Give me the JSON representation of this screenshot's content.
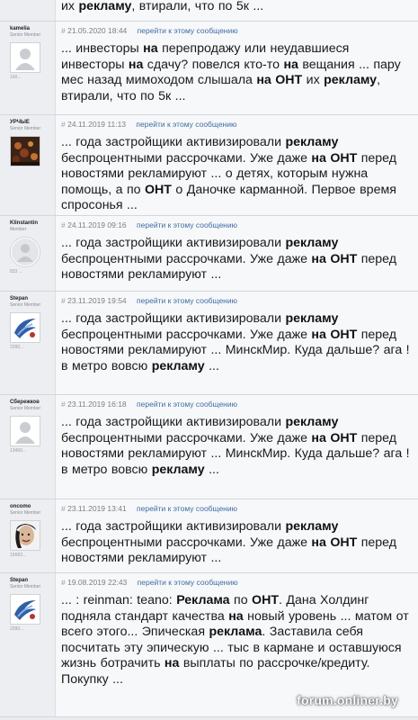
{
  "posts": [
    {
      "author": "",
      "rank": "",
      "count": "",
      "avatar": "none",
      "date": "",
      "link": "",
      "segments": [
        {
          "t": "их ",
          "b": false
        },
        {
          "t": "рекламу",
          "b": true
        },
        {
          "t": ", втирали, что по 5к ...",
          "b": false
        }
      ]
    },
    {
      "author": "kamelia",
      "rank": "Senior Member",
      "count": "160...",
      "avatar": "placeholder",
      "date": "21.05.2020 18:44",
      "link": "перейти к этому сообщению",
      "segments": [
        {
          "t": "... инвесторы ",
          "b": false
        },
        {
          "t": "на",
          "b": true
        },
        {
          "t": " перепродажу или неудавшиеся инвесторы ",
          "b": false
        },
        {
          "t": "на",
          "b": true
        },
        {
          "t": " сдачу? повелся кто-то ",
          "b": false
        },
        {
          "t": "на",
          "b": true
        },
        {
          "t": " вещания ... пару мес назад мимоходом слышала ",
          "b": false
        },
        {
          "t": "на ОНТ",
          "b": true
        },
        {
          "t": " их ",
          "b": false
        },
        {
          "t": "рекламу",
          "b": true
        },
        {
          "t": ", втирали, что по 5к ...",
          "b": false
        }
      ]
    },
    {
      "author": "УРЧЫЕ",
      "rank": "Senior Member",
      "count": "",
      "avatar": "photo-dark",
      "date": "24.11.2019 11:13",
      "link": "перейти к этому сообщению",
      "segments": [
        {
          "t": "... года застройщики активизировали ",
          "b": false
        },
        {
          "t": "рекламу",
          "b": true
        },
        {
          "t": " беспроцентными рассрочками. Уже даже ",
          "b": false
        },
        {
          "t": "на ОНТ",
          "b": true
        },
        {
          "t": " перед новостями рекламируют ... о детях, которым нужна помощь, а по ",
          "b": false
        },
        {
          "t": "ОНТ",
          "b": true
        },
        {
          "t": " о Даночке карманной. Первое время спросонья ...",
          "b": false
        }
      ]
    },
    {
      "author": "Klinstantin",
      "rank": "Member",
      "count": "833 ...",
      "avatar": "placeholder-circle",
      "date": "24.11.2019 09:16",
      "link": "перейти к этому сообщению",
      "segments": [
        {
          "t": "... года застройщики активизировали ",
          "b": false
        },
        {
          "t": "рекламу",
          "b": true
        },
        {
          "t": " беспроцентными рассрочками. Уже даже ",
          "b": false
        },
        {
          "t": "на ОНТ",
          "b": true
        },
        {
          "t": " перед новостями рекламируют ...",
          "b": false
        }
      ]
    },
    {
      "author": "Stepan",
      "rank": "Senior Member",
      "count": "2390...",
      "avatar": "logo-blue",
      "date": "23.11.2019 19:54",
      "link": "перейти к этому сообщению",
      "segments": [
        {
          "t": "... года застройщики активизировали ",
          "b": false
        },
        {
          "t": "рекламу",
          "b": true
        },
        {
          "t": " беспроцентными рассрочками. Уже даже ",
          "b": false
        },
        {
          "t": "на ОНТ",
          "b": true
        },
        {
          "t": " перед новостями рекламируют ... МинскМир. Куда дальше? ага !в метро вовсю ",
          "b": false
        },
        {
          "t": "рекламу",
          "b": true
        },
        {
          "t": " ...",
          "b": false
        }
      ]
    },
    {
      "author": "Сбережков",
      "rank": "Senior Member",
      "count": "13460...",
      "avatar": "placeholder",
      "date": "23.11.2019 16:18",
      "link": "перейти к этому сообщению",
      "segments": [
        {
          "t": "... года застройщики активизировали ",
          "b": false
        },
        {
          "t": "рекламу",
          "b": true
        },
        {
          "t": " беспроцентными рассрочками. Уже даже ",
          "b": false
        },
        {
          "t": "на ОНТ",
          "b": true
        },
        {
          "t": " перед новостями рекламируют ... МинскМир. Куда дальше? ага !в метро вовсю ",
          "b": false
        },
        {
          "t": "рекламу",
          "b": true
        },
        {
          "t": " ...",
          "b": false
        }
      ]
    },
    {
      "author": "oncomo",
      "rank": "Senior Member",
      "count": "15683...",
      "avatar": "photo-face",
      "date": "23.11.2019 13:41",
      "link": "перейти к этому сообщению",
      "segments": [
        {
          "t": "... года застройщики активизировали ",
          "b": false
        },
        {
          "t": "рекламу",
          "b": true
        },
        {
          "t": " беспроцентными рассрочками. Уже даже ",
          "b": false
        },
        {
          "t": "на ОНТ",
          "b": true
        },
        {
          "t": " перед новостями рекламируют ...",
          "b": false
        }
      ]
    },
    {
      "author": "Stepan",
      "rank": "Senior Member",
      "count": "2390...",
      "avatar": "logo-blue",
      "date": "19.08.2019 22:43",
      "link": "перейти к этому сообщению",
      "segments": [
        {
          "t": "... : reinman: teano: ",
          "b": false
        },
        {
          "t": "Реклама",
          "b": true
        },
        {
          "t": " по ",
          "b": false
        },
        {
          "t": "ОНТ",
          "b": true
        },
        {
          "t": ". Дана Холдинг подняла стандарт качества ",
          "b": false
        },
        {
          "t": "на",
          "b": true
        },
        {
          "t": " новый уровень ... матом от всего этого... Эпическая ",
          "b": false
        },
        {
          "t": "реклама",
          "b": true
        },
        {
          "t": ". Заставила себя посчитать эту эпическую ... тыс в кармане и оставшуюся жизнь ботрачить ",
          "b": false
        },
        {
          "t": "на",
          "b": true
        },
        {
          "t": " выплаты по рассрочке/кредиту. Покупку ...",
          "b": false
        }
      ]
    }
  ],
  "watermark": "forum.onliner.by",
  "colors": {
    "background": "#e9ebee",
    "link": "#3d6da6",
    "meta": "#7b7f85"
  }
}
